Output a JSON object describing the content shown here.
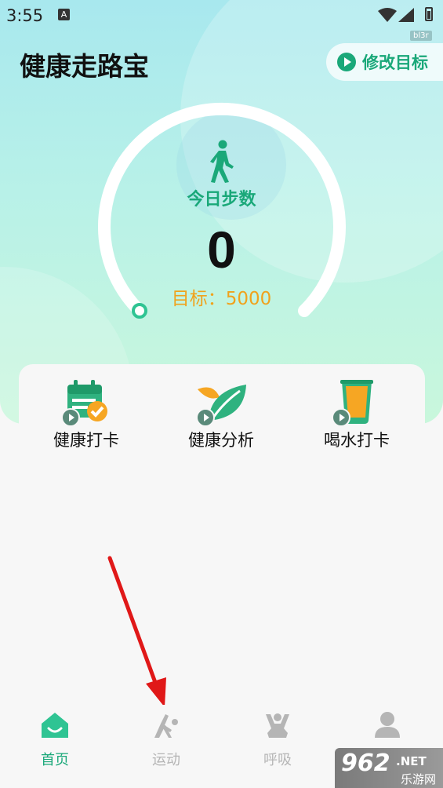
{
  "status_bar": {
    "time": "3:55",
    "notification_icon": "A",
    "tag": "bl3r"
  },
  "header": {
    "title": "健康走路宝",
    "goal_button_label": "修改目标"
  },
  "steps": {
    "label": "今日步数",
    "value": "0",
    "target_text": "目标：5000"
  },
  "features": [
    {
      "label": "健康打卡",
      "icon": "calendar-check-icon"
    },
    {
      "label": "健康分析",
      "icon": "leaf-icon"
    },
    {
      "label": "喝水打卡",
      "icon": "water-glass-icon"
    }
  ],
  "tabs": [
    {
      "label": "首页",
      "icon": "home-icon",
      "active": true
    },
    {
      "label": "运动",
      "icon": "exercise-icon",
      "active": false
    },
    {
      "label": "呼吸",
      "icon": "meditation-icon",
      "active": false
    },
    {
      "label": "我的",
      "icon": "profile-icon",
      "active": false
    }
  ],
  "watermark": {
    "text": "962",
    "suffix": ".NET",
    "subtitle": "乐游网"
  },
  "colors": {
    "accent": "#1aa879",
    "target": "#f0a21c",
    "tab_inactive": "#b5b5b5"
  }
}
